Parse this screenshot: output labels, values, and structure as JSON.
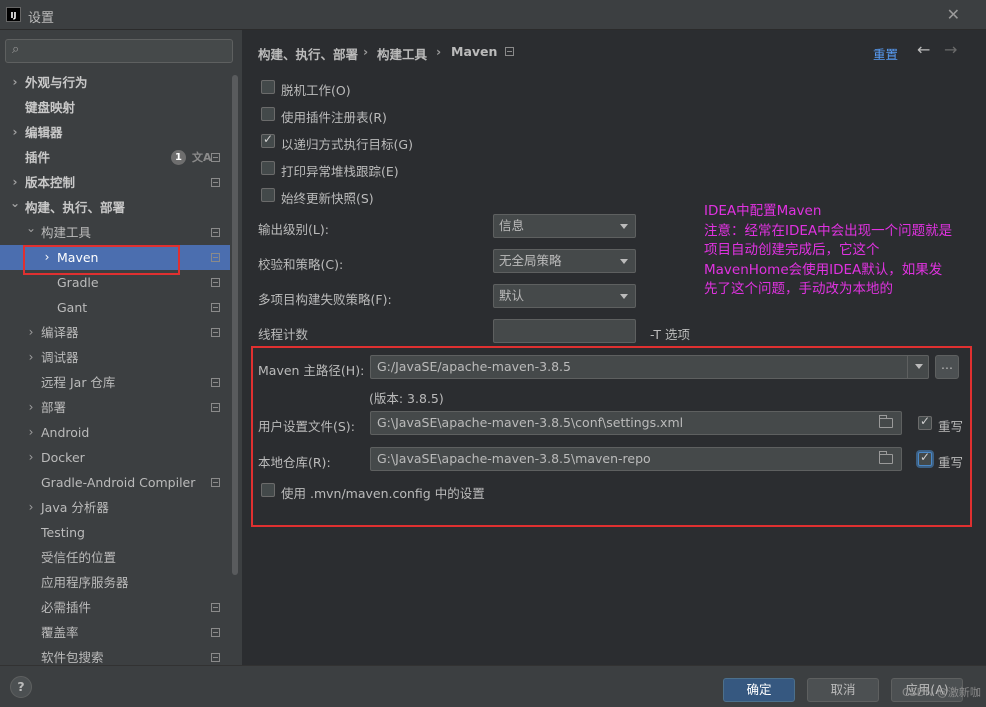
{
  "window": {
    "title": "设置",
    "app_icon": "IJ"
  },
  "sidebar": {
    "search_placeholder": "",
    "items": [
      {
        "label": "外观与行为",
        "expand": "collapsed",
        "indent": 0,
        "bold": true,
        "icon": false
      },
      {
        "label": "键盘映射",
        "expand": "none",
        "indent": 0,
        "bold": true,
        "icon": false
      },
      {
        "label": "编辑器",
        "expand": "collapsed",
        "indent": 0,
        "bold": true,
        "icon": false
      },
      {
        "label": "插件",
        "expand": "none",
        "indent": 0,
        "bold": true,
        "icon": true,
        "badge": "1"
      },
      {
        "label": "版本控制",
        "expand": "collapsed",
        "indent": 0,
        "bold": true,
        "icon": true
      },
      {
        "label": "构建、执行、部署",
        "expand": "expanded",
        "indent": 0,
        "bold": true,
        "icon": false
      },
      {
        "label": "构建工具",
        "expand": "expanded",
        "indent": 1,
        "bold": false,
        "icon": true
      },
      {
        "label": "Maven",
        "expand": "collapsed",
        "indent": 2,
        "bold": false,
        "icon": true,
        "selected": true
      },
      {
        "label": "Gradle",
        "expand": "none",
        "indent": 2,
        "bold": false,
        "icon": true
      },
      {
        "label": "Gant",
        "expand": "none",
        "indent": 2,
        "bold": false,
        "icon": true
      },
      {
        "label": "编译器",
        "expand": "collapsed",
        "indent": 1,
        "bold": false,
        "icon": true
      },
      {
        "label": "调试器",
        "expand": "collapsed",
        "indent": 1,
        "bold": false,
        "icon": false
      },
      {
        "label": "远程 Jar 仓库",
        "expand": "none",
        "indent": 1,
        "bold": false,
        "icon": true
      },
      {
        "label": "部署",
        "expand": "collapsed",
        "indent": 1,
        "bold": false,
        "icon": true
      },
      {
        "label": "Android",
        "expand": "collapsed",
        "indent": 1,
        "bold": false,
        "icon": false
      },
      {
        "label": "Docker",
        "expand": "collapsed",
        "indent": 1,
        "bold": false,
        "icon": false
      },
      {
        "label": "Gradle-Android Compiler",
        "expand": "none",
        "indent": 1,
        "bold": false,
        "icon": true
      },
      {
        "label": "Java 分析器",
        "expand": "collapsed",
        "indent": 1,
        "bold": false,
        "icon": false
      },
      {
        "label": "Testing",
        "expand": "none",
        "indent": 1,
        "bold": false,
        "icon": false
      },
      {
        "label": "受信任的位置",
        "expand": "none",
        "indent": 1,
        "bold": false,
        "icon": false
      },
      {
        "label": "应用程序服务器",
        "expand": "none",
        "indent": 1,
        "bold": false,
        "icon": false
      },
      {
        "label": "必需插件",
        "expand": "none",
        "indent": 1,
        "bold": false,
        "icon": true
      },
      {
        "label": "覆盖率",
        "expand": "none",
        "indent": 1,
        "bold": false,
        "icon": true
      },
      {
        "label": "软件包搜索",
        "expand": "none",
        "indent": 1,
        "bold": false,
        "icon": true
      }
    ]
  },
  "header": {
    "breadcrumb": [
      "构建、执行、部署",
      "构建工具",
      "Maven"
    ],
    "separator": "›",
    "reset": "重置",
    "back": "←",
    "forward": "→"
  },
  "options": {
    "work_offline": {
      "label": "脱机工作(O)",
      "checked": false
    },
    "use_plugin_registry": {
      "label": "使用插件注册表(R)",
      "checked": false
    },
    "recursive": {
      "label": "以递归方式执行目标(G)",
      "checked": true
    },
    "print_stacktrace": {
      "label": "打印异常堆栈跟踪(E)",
      "checked": false
    },
    "always_update": {
      "label": "始终更新快照(S)",
      "checked": false
    }
  },
  "fields": {
    "output_level": {
      "label": "输出级别(L):",
      "value": "信息"
    },
    "checksum": {
      "label": "校验和策略(C):",
      "value": "无全局策略"
    },
    "fail_policy": {
      "label": "多项目构建失败策略(F):",
      "value": "默认"
    },
    "threads": {
      "label": "线程计数",
      "value": "",
      "suffix": "-T 选项"
    }
  },
  "maven": {
    "home_label": "Maven 主路径(H):",
    "home_value": "G:/JavaSE/apache-maven-3.8.5",
    "version": "(版本: 3.8.5)",
    "dots": "...",
    "settings_label": "用户设置文件(S):",
    "settings_value": "G:\\JavaSE\\apache-maven-3.8.5\\conf\\settings.xml",
    "settings_override": "重写",
    "repo_label": "本地仓库(R):",
    "repo_value": "G:\\JavaSE\\apache-maven-3.8.5\\maven-repo",
    "repo_override": "重写",
    "use_config": "使用 .mvn/maven.config 中的设置"
  },
  "annotation": {
    "lines": [
      "IDEA中配置Maven",
      "注意：经常在IDEA中会出现一个问题就是",
      "项目自动创建完成后，它这个",
      "MavenHome会使用IDEA默认，如果发",
      "先了这个问题，手动改为本地的"
    ],
    "color": "#e032e0"
  },
  "footer": {
    "help": "?",
    "ok": "确定",
    "cancel": "取消",
    "apply": "应用(A)",
    "watermark": "CSDN @激新咖"
  },
  "colors": {
    "selection": "#4b6eaf",
    "link": "#589df6",
    "highlight_box": "#e03030"
  }
}
